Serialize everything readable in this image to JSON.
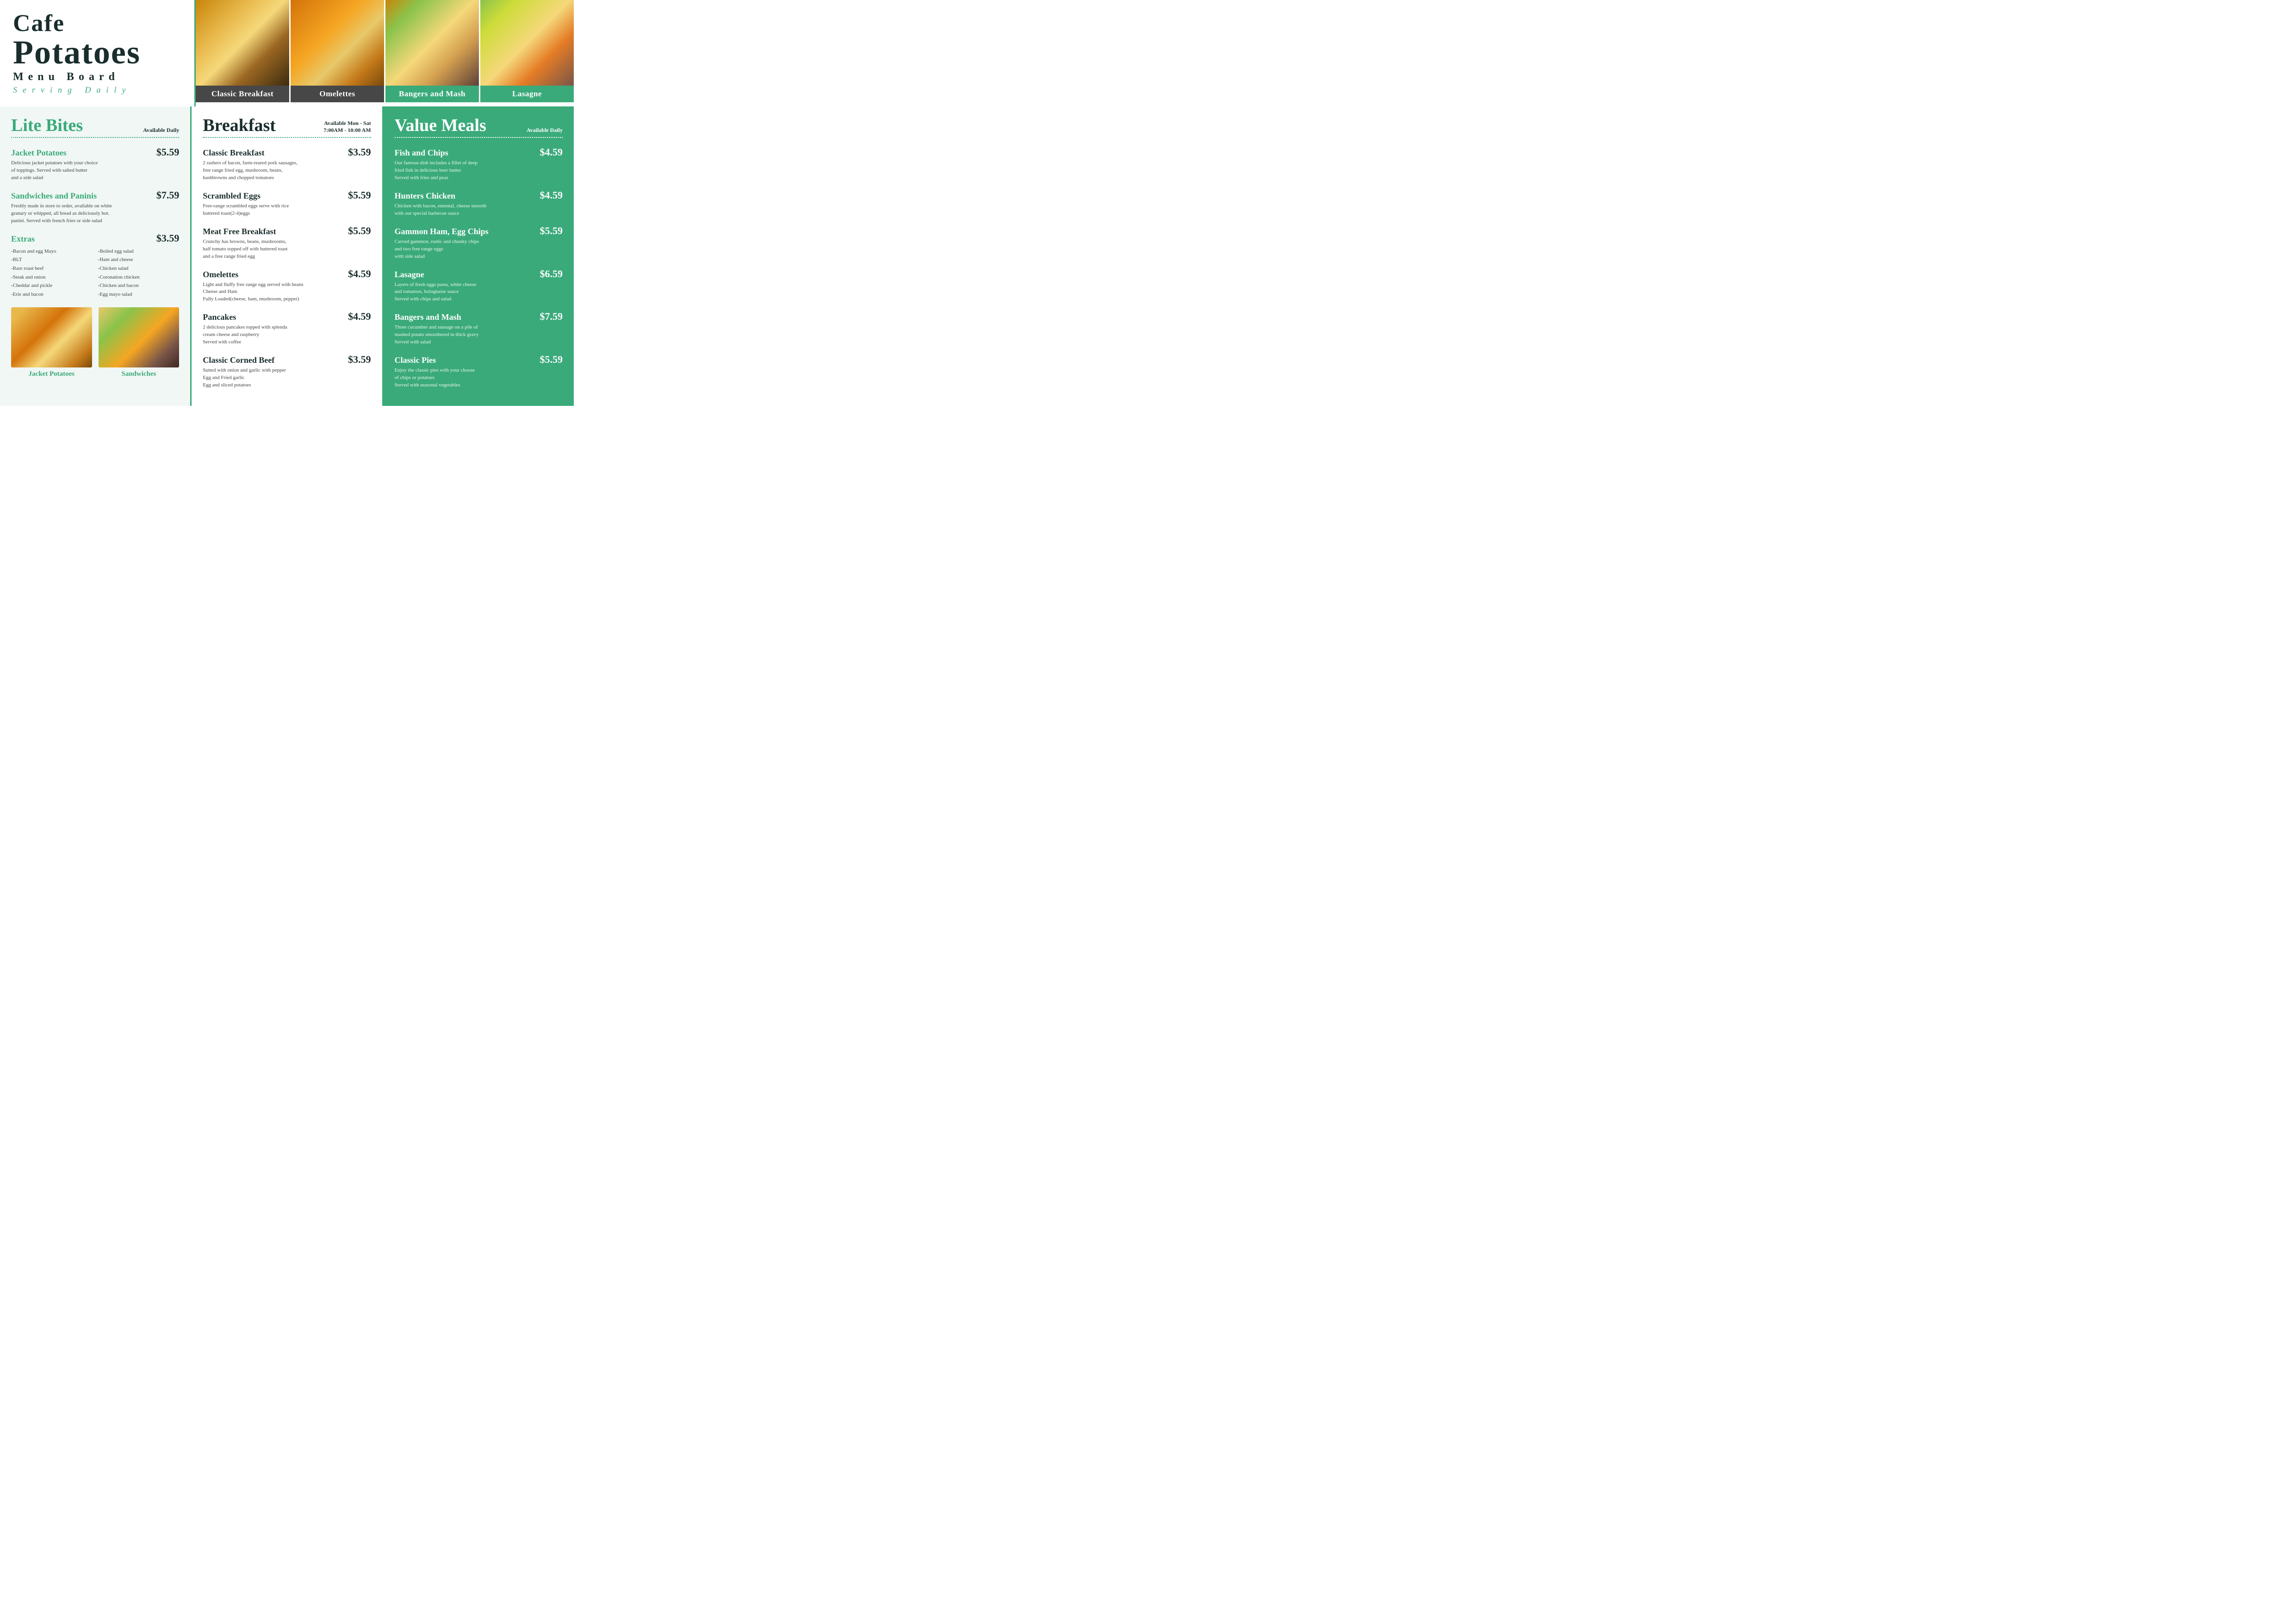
{
  "brand": {
    "line1": "Cafe",
    "line2": "Potatoes",
    "line3": "Menu  Board",
    "line4": "Serving  Daily"
  },
  "header_images": [
    {
      "id": "classic-breakfast",
      "label": "Classic Breakfast",
      "green": false
    },
    {
      "id": "omelettes",
      "label": "Omelettes",
      "green": false
    },
    {
      "id": "bangers-and-mash",
      "label": "Bangers and Mash",
      "green": true
    },
    {
      "id": "lasagne",
      "label": "Lasagne",
      "green": true
    }
  ],
  "lite_bites": {
    "title": "Lite Bites",
    "availability": "Available Daily",
    "items": [
      {
        "name": "Jacket Potatoes",
        "price": "$5.59",
        "desc": "Delicious jacket potatoes with your choice\nof toppings. Served with salted butter\nand a side salad"
      },
      {
        "name": "Sandwiches and Paninis",
        "price": "$7.59",
        "desc": "Freshly made in store to order, available on white\ngranary or whipped, all bread as deliciously hot.\npanini. Served with french fries or side salad"
      },
      {
        "name": "Extras",
        "price": "$3.59",
        "desc": ""
      }
    ],
    "extras_col1": [
      "-Bacon and egg Mayo",
      "-BLT",
      "-Rare roast beef",
      "-Steak and onion",
      "-Cheddar and pickle",
      "-Erie and bacon"
    ],
    "extras_col2": [
      "-Boiled egg salad",
      "-Ham and cheese",
      "-Chicken salad",
      "-Coronation chicken",
      "-Chicken and bacon",
      "-Egg mayo salad"
    ],
    "bottom_images": [
      {
        "id": "jacket-potatoes",
        "label": "Jacket Potatoes"
      },
      {
        "id": "sandwiches",
        "label": "Sandwiches"
      }
    ]
  },
  "breakfast": {
    "title": "Breakfast",
    "avail_line1": "Available Mon - Sat",
    "avail_line2": "7:00AM - 10:00 AM",
    "items": [
      {
        "name": "Classic Breakfast",
        "price": "$3.59",
        "desc": "2 rashers of bacon, farm-reared pork sausages,\nfree range fried egg, mushroom, beans,\nhashbrowns and chopped tomatoes"
      },
      {
        "name": "Scrambled Eggs",
        "price": "$5.59",
        "desc": "Free-range scrambled eggs serve with rice\nbuttered toast(2-4)eggs"
      },
      {
        "name": "Meat Free Breakfast",
        "price": "$5.59",
        "desc": "Crunchy has browns, beans, mushrooms,\nhalf tomato topped off with buttered toast\nand a free range fried egg"
      },
      {
        "name": "Omelettes",
        "price": "$4.59",
        "desc": "Light and fluffy free range egg served with beans\nCheese and Ham\nFully Loaded(cheese, ham, mushroom, pepper)"
      },
      {
        "name": "Pancakes",
        "price": "$4.59",
        "desc": "2 delicious pancakes topped with splenda\ncream cheese and raspberry\nServed with coffee"
      },
      {
        "name": "Classic Corned Beef",
        "price": "$3.59",
        "desc": "Sutted with onion and garlic with pepper\nEgg and Fried garlic\nEgg and sliced potatoes"
      }
    ]
  },
  "value_meals": {
    "title": "Value Meals",
    "availability": "Available Daily",
    "items": [
      {
        "name": "Fish and Chips",
        "price": "$4.59",
        "desc": "Our famous dish includes a fillet of deep\nfried fish in delicious beer butter\nServed with fries and peas"
      },
      {
        "name": "Hunters Chicken",
        "price": "$4.59",
        "desc": "Chicken with bacon, emental, cheese smooth\nwith our special barbecue sauce"
      },
      {
        "name": "Gammon Ham, Egg Chips",
        "price": "$5.59",
        "desc": "Carved gammon, rustic and chunky chips\nand two free range eggs\nwith side salad"
      },
      {
        "name": "Lasagne",
        "price": "$6.59",
        "desc": "Layers of fresh eggs pasta, white cheese\nand tomatoes, bolognaise sauce\nServed with chips and salad"
      },
      {
        "name": "Bangers and Mash",
        "price": "$7.59",
        "desc": "Three cucumber and sausage on a pile of\nmashed potato smoothered in thick gravy\nServed with salad"
      },
      {
        "name": "Classic Pies",
        "price": "$5.59",
        "desc": "Enjoy the classic pies with your choose\nof chips or potatoes\nServed with seasonal vegetables"
      }
    ]
  }
}
